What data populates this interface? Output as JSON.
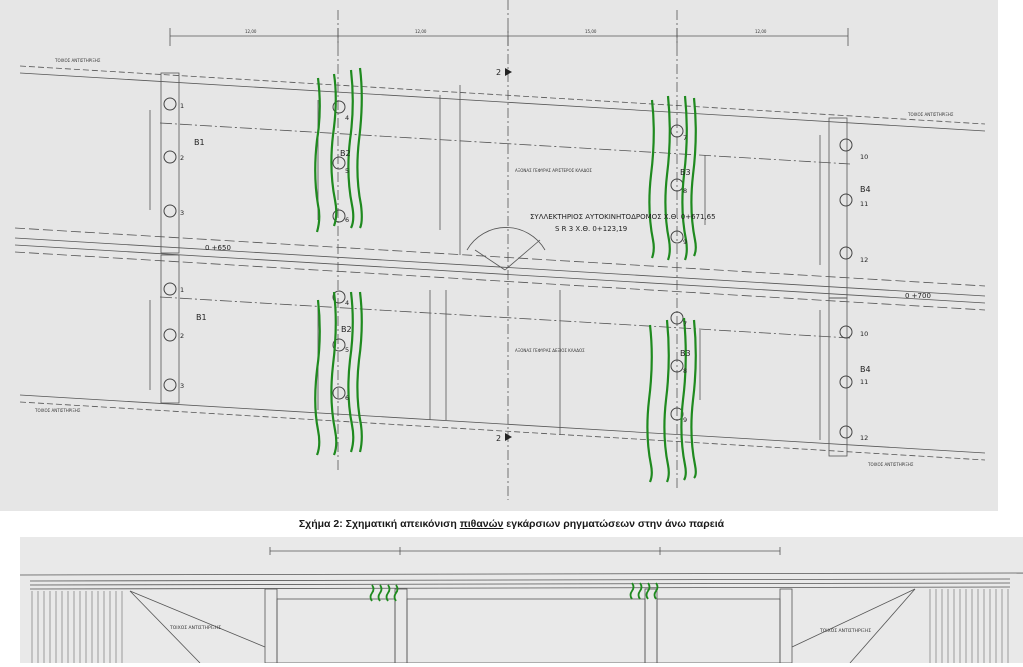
{
  "plan": {
    "dimensions_top": [
      "12,00",
      "12,00",
      "15,00",
      "12,00"
    ],
    "abutment_label": "ΤΟΙΧΟΣ ΑΝΤΙΣΤΗΡΙΞΗΣ",
    "piers": [
      "B1",
      "B2",
      "B3",
      "B4"
    ],
    "pile_numbers_b1_upper": [
      "1",
      "2",
      "3"
    ],
    "pile_numbers_b1_lower": [
      "1",
      "2",
      "3"
    ],
    "pile_numbers_b2_upper": [
      "4",
      "5",
      "6"
    ],
    "pile_numbers_b2_lower": [
      "4",
      "5",
      "6"
    ],
    "pile_numbers_b3_upper": [
      "7",
      "8",
      "9"
    ],
    "pile_numbers_b3_lower": [
      "7",
      "8",
      "9"
    ],
    "pile_numbers_b4_upper": [
      "10",
      "11",
      "12"
    ],
    "pile_numbers_b4_lower": [
      "10",
      "11",
      "12"
    ],
    "axis_upper": "ΑΞΟΝΑΣ ΓΕΦΥΡΑΣ ΑΡΙΣΤΕΡΟΣ ΚΛΑΔΟΣ",
    "axis_lower": "ΑΞΟΝΑΣ ΓΕΦΥΡΑΣ ΔΕΞΙΟΣ ΚΛΑΔΟΣ",
    "road_line1": "ΣΥΛΛΕΚΤΗΡΙΟΣ ΑΥΤΟΚΙΝΗΤΟΔΡΟΜΟΣ Χ.Θ. 0+671,65",
    "road_line2": "S R 3 Χ.Θ. 0+123,19",
    "chainage_left": "0 +650",
    "chainage_right": "0 +700",
    "section_mark": "2",
    "crack_color": "#1f8a1f"
  },
  "caption": {
    "prefix": "Σχήμα 2: Σχηματική απεικόνιση ",
    "underlined": "πιθανών",
    "suffix": " εγκάρσιων ρηγματώσεων στην άνω παρειά"
  },
  "elevation": {
    "abutment_label": "ΤΟΙΧΟΣ ΑΝΤΙΣΤΗΡΙΞΗΣ"
  }
}
